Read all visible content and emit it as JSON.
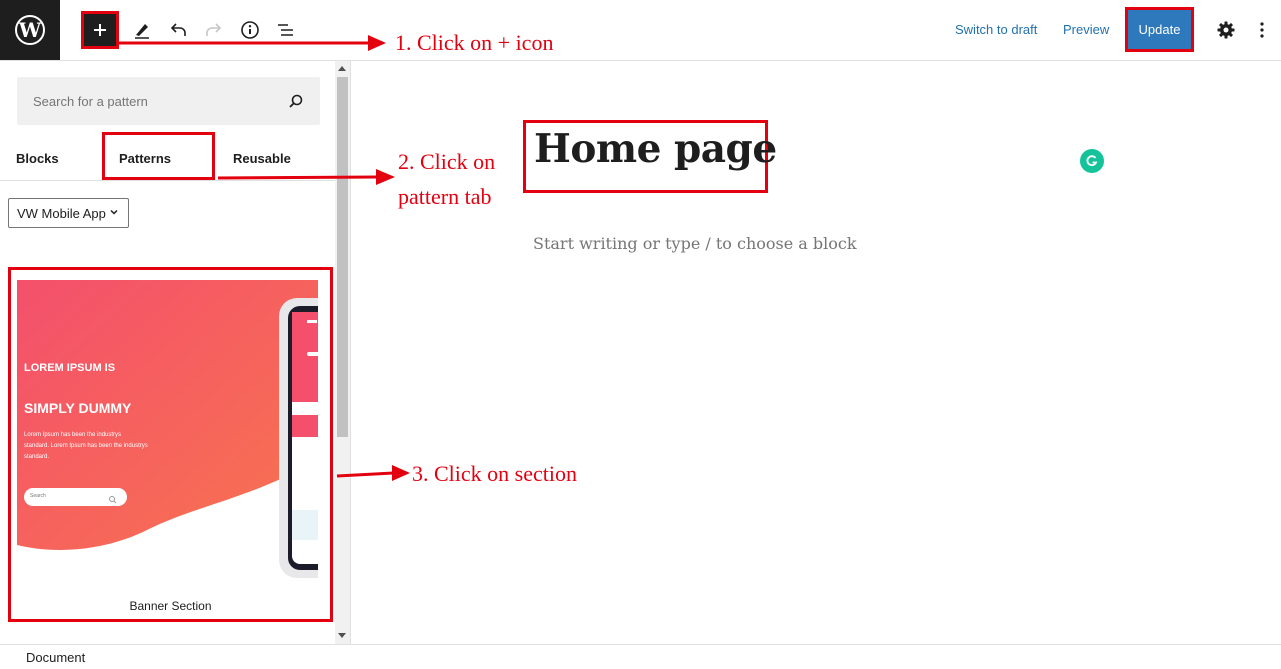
{
  "toolbar": {
    "switch_to_draft": "Switch to draft",
    "preview": "Preview",
    "update": "Update",
    "icons": [
      "wordpress-logo",
      "plus-icon",
      "pencil-icon",
      "undo-icon",
      "redo-icon",
      "info-icon",
      "list-view-icon",
      "gear-icon",
      "more-vertical-icon"
    ]
  },
  "inserter": {
    "search_placeholder": "Search for a pattern",
    "tabs": [
      "Blocks",
      "Patterns",
      "Reusable"
    ],
    "category": "VW Mobile App",
    "pattern": {
      "name": "Banner Section",
      "preview_heading_1": "LOREM IPSUM IS",
      "preview_heading_2": "SIMPLY DUMMY",
      "preview_text_1": "Lorem Ipsum has been the industrys",
      "preview_text_2": "standard. Lorem Ipsum has been the industrys",
      "preview_text_3": "standard.",
      "preview_search": "Search"
    }
  },
  "editor": {
    "title": "Home page",
    "placeholder": "Start writing or type / to choose a block"
  },
  "footer": {
    "breadcrumb": "Document"
  },
  "annotations": {
    "step1": "1. Click on + icon",
    "step2_line1": "2. Click on",
    "step2_line2": "pattern tab",
    "step3": "3. Click on section"
  },
  "colors": {
    "annotation": "#e3000f",
    "update_button": "#2e79bb",
    "link": "#2271b1",
    "pattern_gradient": [
      "#f5566a",
      "#f86f4f"
    ]
  }
}
